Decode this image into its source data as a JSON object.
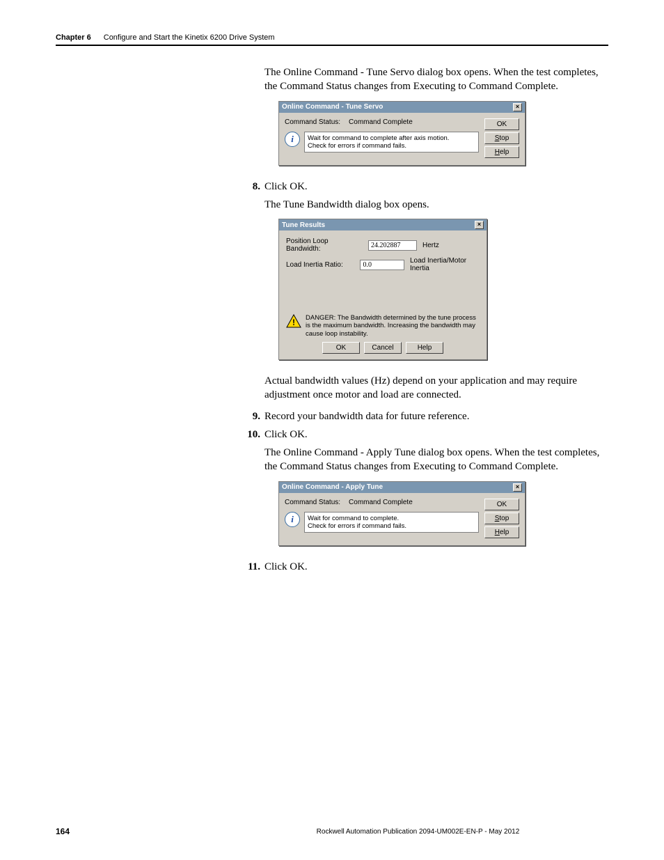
{
  "header": {
    "chapter_num": "Chapter 6",
    "chapter_title": "Configure and Start the Kinetix 6200 Drive System"
  },
  "body": {
    "p1": "The Online Command - Tune Servo dialog box opens. When the test completes, the Command Status changes from Executing to Command Complete.",
    "step8_num": "8.",
    "step8_text": "Click OK.",
    "p2": "The Tune Bandwidth dialog box opens.",
    "p3": "Actual bandwidth values (Hz) depend on your application and may require adjustment once motor and load are connected.",
    "step9_num": "9.",
    "step9_text": "Record your bandwidth data for future reference.",
    "step10_num": "10.",
    "step10_text": "Click OK.",
    "p4": "The Online Command - Apply Tune dialog box opens. When the test completes, the Command Status changes from Executing to Command Complete.",
    "step11_num": "11.",
    "step11_text": "Click OK."
  },
  "dlg1": {
    "title": "Online Command - Tune Servo",
    "close": "×",
    "status_label": "Command Status:",
    "status_value": "Command Complete",
    "info_text": "Wait for command to complete after axis motion.\nCheck for errors if command fails.",
    "ok": "OK",
    "stop_u": "S",
    "stop_rest": "top",
    "help_u": "H",
    "help_rest": "elp"
  },
  "dlg2": {
    "title": "Tune Results",
    "close": "×",
    "field1_label": "Position Loop Bandwidth:",
    "field1_value": "24.202887",
    "field1_unit": "Hertz",
    "field2_label": "Load Inertia Ratio:",
    "field2_value": "0.0",
    "field2_unit": "Load Inertia/Motor Inertia",
    "warn_text": "DANGER: The Bandwidth determined by the tune process is the maximum bandwidth. Increasing the bandwidth may cause loop instability.",
    "ok": "OK",
    "cancel": "Cancel",
    "help": "Help"
  },
  "dlg3": {
    "title": "Online Command - Apply Tune",
    "close": "×",
    "status_label": "Command Status:",
    "status_value": "Command Complete",
    "info_text": "Wait for command to complete.\nCheck for errors if command fails.",
    "ok": "OK",
    "stop_u": "S",
    "stop_rest": "top",
    "help_u": "H",
    "help_rest": "elp"
  },
  "footer": {
    "page": "164",
    "pub": "Rockwell Automation Publication 2094-UM002E-EN-P - May 2012"
  }
}
